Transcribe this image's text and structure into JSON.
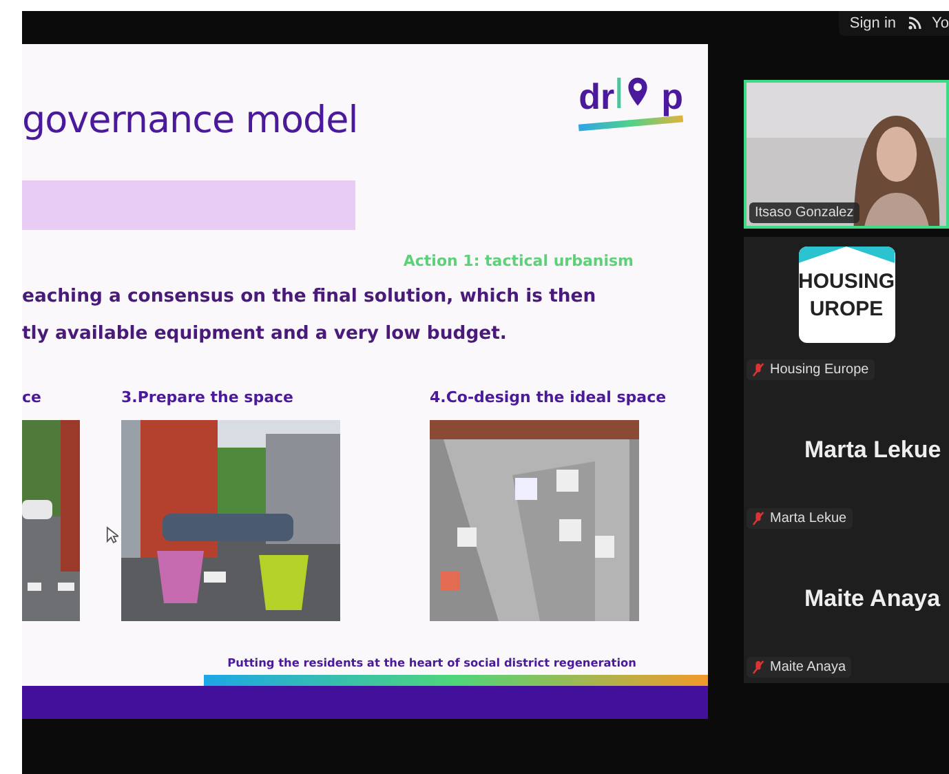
{
  "top_bar": {
    "sign_in": "Sign in",
    "cut_label": "Yo"
  },
  "slide": {
    "title": "governance model",
    "logo": {
      "left": "dr",
      "right": "p"
    },
    "action": "Action 1: tactical urbanism",
    "paragraph": [
      "eaching a consensus on the final solution, which is then",
      "tly available equipment and a very low budget."
    ],
    "steps": [
      {
        "heading": "ce"
      },
      {
        "heading": "3.Prepare the space"
      },
      {
        "heading": "4.Co-design the ideal space"
      }
    ],
    "footer": "Putting the residents at the heart of social district regeneration"
  },
  "participants": [
    {
      "kind": "video",
      "name": "Itsaso Gonzalez",
      "speaking": true,
      "muted": false
    },
    {
      "kind": "logo",
      "name": "Housing Europe",
      "logo_lines": [
        "HOUSING",
        "UROPE"
      ],
      "speaking": false,
      "muted": true
    },
    {
      "kind": "name",
      "name": "Marta Lekue",
      "display": "Marta Lekue",
      "speaking": false,
      "muted": true
    },
    {
      "kind": "name",
      "name": "Maite Anaya",
      "display": "Maite Anaya",
      "speaking": false,
      "muted": true
    }
  ]
}
